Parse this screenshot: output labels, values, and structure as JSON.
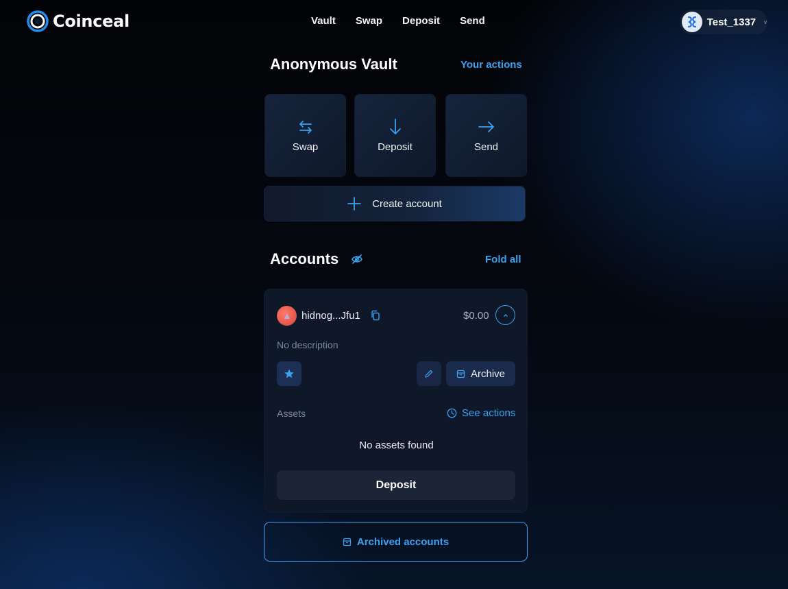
{
  "app": {
    "name": "Coinceal"
  },
  "nav": {
    "items": [
      {
        "label": "Vault"
      },
      {
        "label": "Swap"
      },
      {
        "label": "Deposit"
      },
      {
        "label": "Send"
      }
    ]
  },
  "user": {
    "name": "Test_1337"
  },
  "vault": {
    "title": "Anonymous Vault",
    "your_actions": "Your actions",
    "actions": [
      {
        "label": "Swap",
        "icon": "swap-arrows-icon"
      },
      {
        "label": "Deposit",
        "icon": "arrow-down-icon"
      },
      {
        "label": "Send",
        "icon": "arrow-right-icon"
      }
    ],
    "create_account": "Create account"
  },
  "accounts": {
    "title": "Accounts",
    "fold_all": "Fold all",
    "items": [
      {
        "name": "hidnog...Jfu1",
        "balance": "$0.00",
        "description": "No description",
        "archive_label": "Archive",
        "assets_label": "Assets",
        "see_actions": "See actions",
        "no_assets": "No assets found",
        "deposit_label": "Deposit"
      }
    ],
    "archived_accounts": "Archived accounts"
  },
  "colors": {
    "accent": "#3aa2f0",
    "card": "#0f1829",
    "background": "#03060c"
  }
}
